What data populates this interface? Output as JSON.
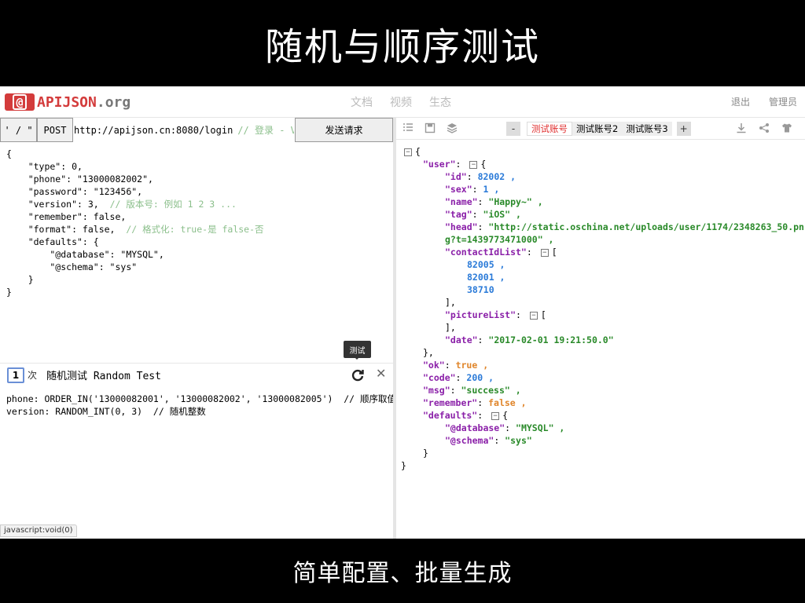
{
  "slide": {
    "title": "随机与顺序测试",
    "caption": "简单配置、批量生成"
  },
  "nav": {
    "logo_badge": "@",
    "logo_text": "APIJSON",
    "logo_suffix": ".org",
    "center": [
      "文档",
      "视频",
      "生态"
    ],
    "logout": "退出",
    "admin": "管理员"
  },
  "toolbar": {
    "type_label": "' / \"",
    "method_label": "POST",
    "url": "http://apijson.cn:8080/login",
    "url_comment": "// 登录 - V*",
    "send_label": "发送请求"
  },
  "request": {
    "lines": [
      {
        "text": "{",
        "comment": ""
      },
      {
        "text": "    \"type\": 0,",
        "comment": ""
      },
      {
        "text": "    \"phone\": \"13000082002\",",
        "comment": ""
      },
      {
        "text": "    \"password\": \"123456\",",
        "comment": ""
      },
      {
        "text": "    \"version\": 3,  ",
        "comment": "// 版本号: 例如 1 2 3 ..."
      },
      {
        "text": "    \"remember\": false,",
        "comment": ""
      },
      {
        "text": "    \"format\": false,  ",
        "comment": "// 格式化: true-是 false-否"
      },
      {
        "text": "    \"defaults\": {",
        "comment": ""
      },
      {
        "text": "        \"@database\": \"MYSQL\",",
        "comment": ""
      },
      {
        "text": "        \"@schema\": \"sys\"",
        "comment": ""
      },
      {
        "text": "    }",
        "comment": ""
      },
      {
        "text": "}",
        "comment": ""
      }
    ]
  },
  "tooltip": "测试",
  "random": {
    "count": "1",
    "times_label": "次",
    "title": "随机测试 Random Test",
    "config_lines": [
      "phone: ORDER_IN('13000082001', '13000082002', '13000082005')  // 顺序取值",
      "version: RANDOM_INT(0, 3)  // 随机整数"
    ]
  },
  "status_url": "javascript:void(0)",
  "right_toolbar": {
    "minus": "-",
    "plus": "+",
    "tabs": [
      "测试账号",
      "测试账号2",
      "测试账号3"
    ],
    "active_tab": "测试账号"
  },
  "response": {
    "lines": [
      {
        "fold": true,
        "parts": [
          {
            "t": "{",
            "c": ""
          }
        ]
      },
      {
        "fold": false,
        "indent": 1,
        "parts": [
          {
            "t": "\"user\"",
            "c": "k"
          },
          {
            "t": ": ",
            "c": ""
          },
          {
            "t": "fold",
            "c": "fold"
          },
          {
            "t": "{",
            "c": ""
          }
        ]
      },
      {
        "indent": 2,
        "parts": [
          {
            "t": "\"id\"",
            "c": "k"
          },
          {
            "t": ": ",
            "c": ""
          },
          {
            "t": "82002",
            "c": "n"
          },
          {
            "t": " ,",
            "c": "n"
          }
        ]
      },
      {
        "indent": 2,
        "parts": [
          {
            "t": "\"sex\"",
            "c": "k"
          },
          {
            "t": ": ",
            "c": ""
          },
          {
            "t": "1",
            "c": "n"
          },
          {
            "t": " ,",
            "c": "n"
          }
        ]
      },
      {
        "indent": 2,
        "parts": [
          {
            "t": "\"name\"",
            "c": "k"
          },
          {
            "t": ": ",
            "c": ""
          },
          {
            "t": "\"Happy~\"",
            "c": "s"
          },
          {
            "t": " ,",
            "c": "s"
          }
        ]
      },
      {
        "indent": 2,
        "parts": [
          {
            "t": "\"tag\"",
            "c": "k"
          },
          {
            "t": ": ",
            "c": ""
          },
          {
            "t": "\"iOS\"",
            "c": "s"
          },
          {
            "t": " ,",
            "c": "s"
          }
        ]
      },
      {
        "indent": 2,
        "parts": [
          {
            "t": "\"head\"",
            "c": "k"
          },
          {
            "t": ": ",
            "c": ""
          },
          {
            "t": "\"http://static.oschina.net/uploads/user/1174/2348263_50.pn",
            "c": "s"
          }
        ]
      },
      {
        "indent": 2,
        "parts": [
          {
            "t": "g?t=1439773471000\"",
            "c": "s"
          },
          {
            "t": " ,",
            "c": "s"
          }
        ]
      },
      {
        "indent": 2,
        "parts": [
          {
            "t": "\"contactIdList\"",
            "c": "k"
          },
          {
            "t": ": ",
            "c": ""
          },
          {
            "t": "fold",
            "c": "fold"
          },
          {
            "t": "[",
            "c": ""
          }
        ]
      },
      {
        "indent": 3,
        "parts": [
          {
            "t": "82005",
            "c": "n"
          },
          {
            "t": " ,",
            "c": "n"
          }
        ]
      },
      {
        "indent": 3,
        "parts": [
          {
            "t": "82001",
            "c": "n"
          },
          {
            "t": " ,",
            "c": "n"
          }
        ]
      },
      {
        "indent": 3,
        "parts": [
          {
            "t": "38710",
            "c": "n"
          }
        ]
      },
      {
        "indent": 2,
        "parts": [
          {
            "t": "],",
            "c": ""
          }
        ]
      },
      {
        "indent": 2,
        "parts": [
          {
            "t": "\"pictureList\"",
            "c": "k"
          },
          {
            "t": ": ",
            "c": ""
          },
          {
            "t": "fold",
            "c": "fold"
          },
          {
            "t": "[",
            "c": ""
          }
        ]
      },
      {
        "indent": 2,
        "parts": [
          {
            "t": "],",
            "c": ""
          }
        ]
      },
      {
        "indent": 2,
        "parts": [
          {
            "t": "\"date\"",
            "c": "k"
          },
          {
            "t": ": ",
            "c": ""
          },
          {
            "t": "\"2017-02-01 19:21:50.0\"",
            "c": "s"
          }
        ]
      },
      {
        "indent": 1,
        "parts": [
          {
            "t": "},",
            "c": ""
          }
        ]
      },
      {
        "indent": 1,
        "parts": [
          {
            "t": "\"ok\"",
            "c": "k"
          },
          {
            "t": ": ",
            "c": ""
          },
          {
            "t": "true",
            "c": "b"
          },
          {
            "t": " ,",
            "c": "b"
          }
        ]
      },
      {
        "indent": 1,
        "parts": [
          {
            "t": "\"code\"",
            "c": "k"
          },
          {
            "t": ": ",
            "c": ""
          },
          {
            "t": "200",
            "c": "n"
          },
          {
            "t": " ,",
            "c": "n"
          }
        ]
      },
      {
        "indent": 1,
        "parts": [
          {
            "t": "\"msg\"",
            "c": "k"
          },
          {
            "t": ": ",
            "c": ""
          },
          {
            "t": "\"success\"",
            "c": "s"
          },
          {
            "t": " ,",
            "c": "s"
          }
        ]
      },
      {
        "indent": 1,
        "parts": [
          {
            "t": "\"remember\"",
            "c": "k"
          },
          {
            "t": ": ",
            "c": ""
          },
          {
            "t": "false",
            "c": "b"
          },
          {
            "t": " ,",
            "c": "b"
          }
        ]
      },
      {
        "indent": 1,
        "parts": [
          {
            "t": "\"defaults\"",
            "c": "k"
          },
          {
            "t": ": ",
            "c": ""
          },
          {
            "t": "fold",
            "c": "fold"
          },
          {
            "t": "{",
            "c": ""
          }
        ]
      },
      {
        "indent": 2,
        "parts": [
          {
            "t": "\"@database\"",
            "c": "k"
          },
          {
            "t": ": ",
            "c": ""
          },
          {
            "t": "\"MYSQL\"",
            "c": "s"
          },
          {
            "t": " ,",
            "c": "s"
          }
        ]
      },
      {
        "indent": 2,
        "parts": [
          {
            "t": "\"@schema\"",
            "c": "k"
          },
          {
            "t": ": ",
            "c": ""
          },
          {
            "t": "\"sys\"",
            "c": "s"
          }
        ]
      },
      {
        "indent": 1,
        "parts": [
          {
            "t": "}",
            "c": ""
          }
        ]
      },
      {
        "indent": 0,
        "parts": [
          {
            "t": "}",
            "c": ""
          }
        ]
      }
    ]
  },
  "icons": {
    "format": "list-icon",
    "save": "save-icon",
    "layers": "layers-icon",
    "download": "download-icon",
    "share": "share-icon",
    "theme": "shirt-icon",
    "refresh": "refresh-icon",
    "close": "close-icon"
  },
  "colors": {
    "brand": "#d33b3b",
    "key": "#8a1fa8",
    "string": "#2a8a2a",
    "number": "#2a7ad8",
    "boolean": "#e0852a",
    "comment": "#8bbf8b"
  }
}
